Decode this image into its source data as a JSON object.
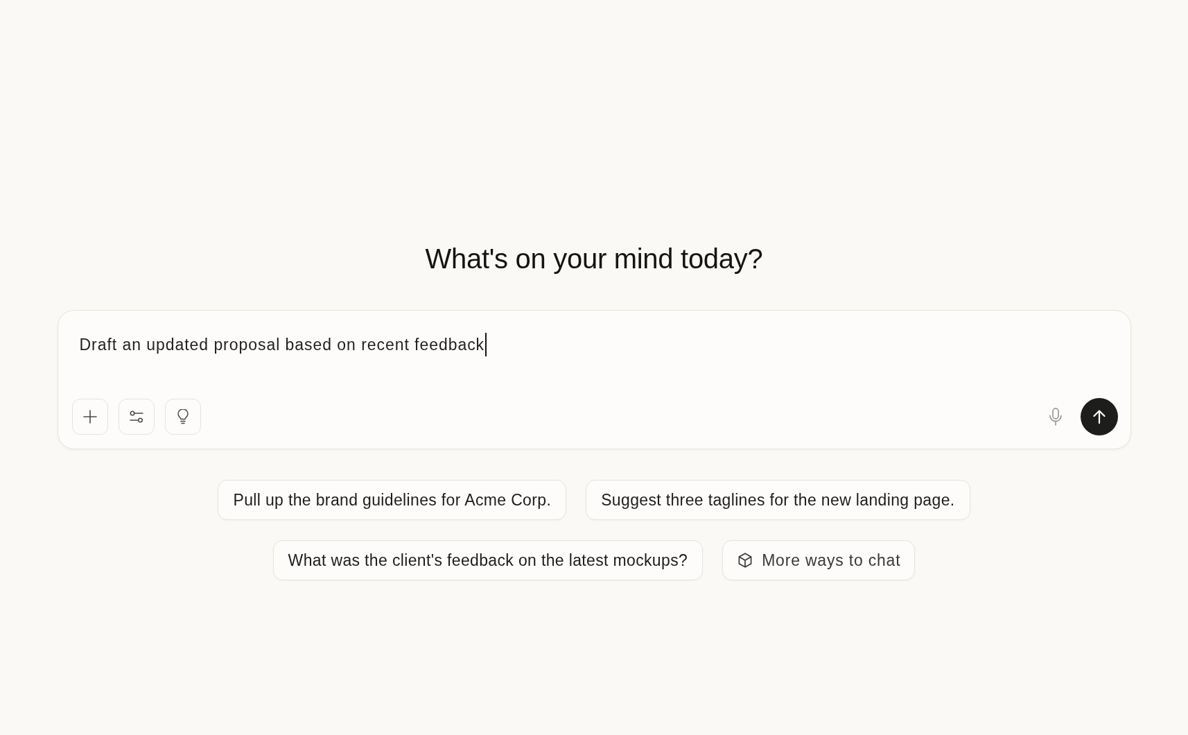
{
  "heading": "What's on your mind today?",
  "composer": {
    "value": "Draft an updated proposal based on recent feedback",
    "focused": true
  },
  "suggestion_rows": [
    {
      "items": [
        {
          "kind": "prompt",
          "label": "Pull up the brand guidelines for Acme Corp."
        },
        {
          "kind": "prompt",
          "label": "Suggest three taglines for the new landing page."
        }
      ]
    },
    {
      "items": [
        {
          "kind": "prompt",
          "label": "What was the client's feedback on the latest mockups?"
        },
        {
          "kind": "more",
          "label": "More ways to chat"
        }
      ]
    }
  ]
}
